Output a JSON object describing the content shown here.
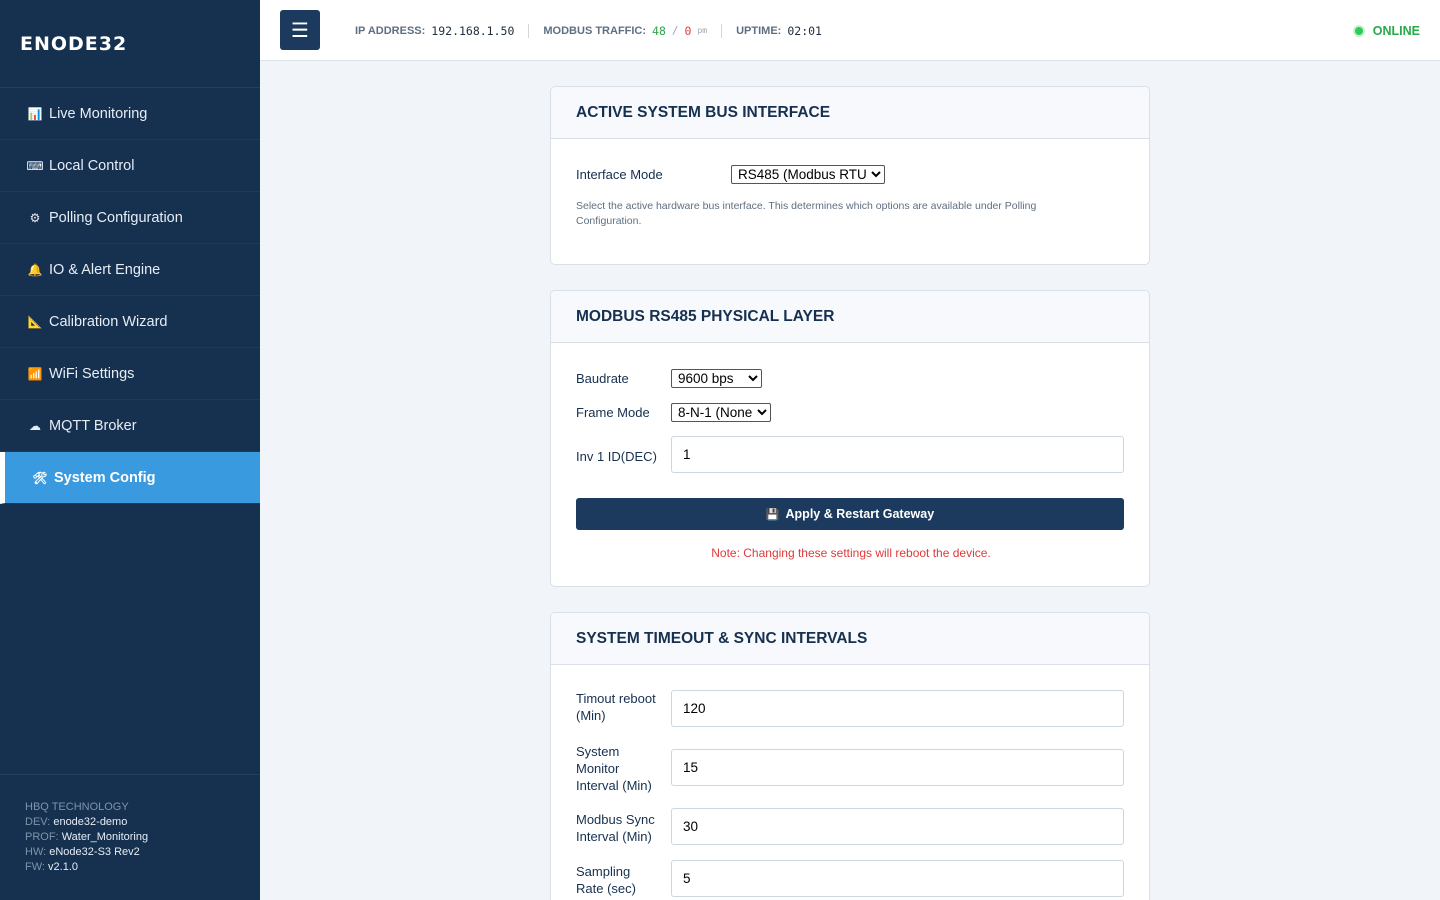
{
  "brand": "ENODE32",
  "sidebar": {
    "items": [
      {
        "icon": "bar-chart-icon",
        "glyph": "📊",
        "label": "Live Monitoring"
      },
      {
        "icon": "keyboard-icon",
        "glyph": "⌨",
        "label": "Local Control"
      },
      {
        "icon": "gear-icon",
        "glyph": "⚙",
        "label": "Polling Configuration"
      },
      {
        "icon": "bell-icon",
        "glyph": "🔔",
        "label": "IO & Alert Engine"
      },
      {
        "icon": "ruler-icon",
        "glyph": "📐",
        "label": "Calibration Wizard"
      },
      {
        "icon": "wifi-icon",
        "glyph": "📶",
        "label": "WiFi Settings"
      },
      {
        "icon": "cloud-icon",
        "glyph": "☁",
        "label": "MQTT Broker"
      },
      {
        "icon": "tools-icon",
        "glyph": "🛠",
        "label": "System Config",
        "active": true
      }
    ],
    "footer": {
      "company": "HBQ TECHNOLOGY",
      "dev_label": "DEV:",
      "dev": "enode32-demo",
      "prof_label": "PROF:",
      "prof": "Water_Monitoring",
      "hw_label": "HW:",
      "hw": "eNode32-S3 Rev2",
      "fw_label": "FW:",
      "fw": "v2.1.0"
    }
  },
  "topbar": {
    "menu_glyph": "☰",
    "ip_label": "IP ADDRESS:",
    "ip": "192.168.1.50",
    "traffic_label": "MODBUS TRAFFIC:",
    "traffic_ok": "48",
    "traffic_sep": "/",
    "traffic_err": "0",
    "traffic_unit": "pm",
    "uptime_label": "UPTIME:",
    "uptime": "02:01",
    "status": "ONLINE",
    "colors": {
      "online": "#2aa84a",
      "error": "#e03a3a",
      "accent": "#3a9ae0",
      "sidebar": "#16304f"
    }
  },
  "bus_card": {
    "title": "ACTIVE SYSTEM BUS INTERFACE",
    "mode_label": "Interface Mode",
    "mode_value": "RS485 (Modbus RTU)",
    "help": "Select the active hardware bus interface. This determines which options are available under Polling Configuration."
  },
  "rs485_card": {
    "title": "MODBUS RS485 PHYSICAL LAYER",
    "baud_label": "Baudrate",
    "baud_value": "9600 bps",
    "frame_label": "Frame Mode",
    "frame_value": "8-N-1 (None)",
    "inv_label": "Inv 1 ID(DEC)",
    "inv_value": "1",
    "apply_label": "Apply & Restart Gateway",
    "apply_glyph": "💾",
    "note": "Note: Changing these settings will reboot the device."
  },
  "timeout_card": {
    "title": "SYSTEM TIMEOUT & SYNC INTERVALS",
    "fields": [
      {
        "label": "Timout reboot (Min)",
        "value": "120"
      },
      {
        "label": "System Monitor Interval (Min)",
        "value": "15"
      },
      {
        "label": "Modbus Sync Interval (Min)",
        "value": "30"
      },
      {
        "label": "Sampling Rate (sec)",
        "value": "5"
      }
    ]
  }
}
